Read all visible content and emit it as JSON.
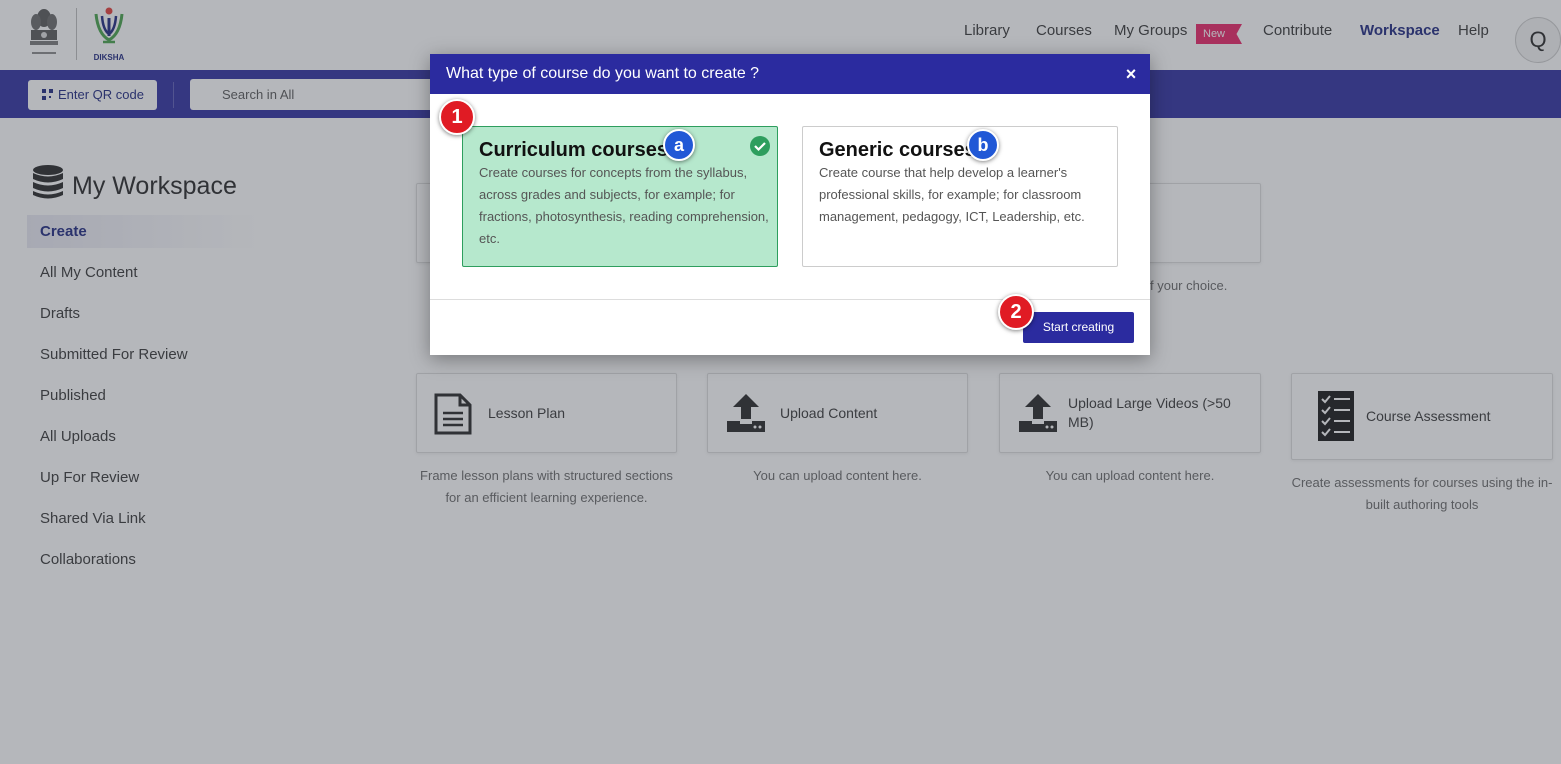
{
  "header": {
    "logo_text": "DIKSHA",
    "nav": [
      {
        "label": "Library"
      },
      {
        "label": "Courses"
      },
      {
        "label": "My Groups"
      },
      {
        "label": "Contribute"
      },
      {
        "label": "Workspace"
      },
      {
        "label": "Help"
      }
    ],
    "new_badge": "New",
    "avatar_initial": "Q"
  },
  "topbar": {
    "qr_label": "Enter QR code",
    "search_placeholder": "Search in All"
  },
  "sidebar": {
    "title": "My Workspace",
    "items": [
      {
        "label": "Create"
      },
      {
        "label": "All My Content"
      },
      {
        "label": "Drafts"
      },
      {
        "label": "Submitted For Review"
      },
      {
        "label": "Published"
      },
      {
        "label": "All Uploads"
      },
      {
        "label": "Up For Review"
      },
      {
        "label": "Shared Via Link"
      },
      {
        "label": "Collaborations"
      }
    ]
  },
  "main": {
    "partial_desc": "f your choice.",
    "cards": [
      {
        "label": "Lesson Plan",
        "desc": "Frame lesson plans with structured sections for an efficient learning experience.",
        "icon": "document-icon"
      },
      {
        "label": "Upload Content",
        "desc": "You can upload content here.",
        "icon": "upload-icon"
      },
      {
        "label": "Upload Large Videos (>50 MB)",
        "desc": "You can upload content here.",
        "icon": "upload-icon"
      },
      {
        "label": "Course Assessment",
        "desc": "Create assessments for courses using the in-built authoring tools",
        "icon": "checklist-icon"
      }
    ]
  },
  "modal": {
    "title": "What type of course do you want to create ?",
    "close": "×",
    "options": [
      {
        "title": "Curriculum courses",
        "desc": "Create courses for concepts from the syllabus, across grades and subjects, for example; for fractions, photosynthesis, reading comprehension, etc.",
        "selected": true
      },
      {
        "title": "Generic courses",
        "desc": "Create course that help develop a learner's professional skills, for example; for classroom management, pedagogy, ICT, Leadership, etc.",
        "selected": false
      }
    ],
    "start_button": "Start creating"
  },
  "callouts": {
    "one": "1",
    "two": "2",
    "a": "a",
    "b": "b"
  },
  "colors": {
    "primary": "#2b2b9f",
    "selected_bg": "#b6e8cd",
    "callout_red": "#e01b24",
    "callout_blue": "#2158d6",
    "new_badge": "#e91e63"
  }
}
